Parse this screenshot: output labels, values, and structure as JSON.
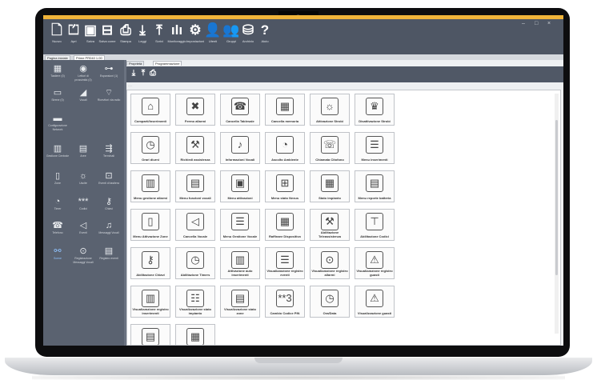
{
  "colors": {
    "accent": "#f0b43a",
    "titlebar": "#4e5664",
    "sidebar": "#5a6270",
    "selected": "#8fc3ff"
  },
  "toolbar": [
    {
      "label": "Nuovo",
      "icon": "new-file-icon",
      "glyph": "🗋"
    },
    {
      "label": "Apri",
      "icon": "open-file-icon",
      "glyph": "⏍"
    },
    {
      "label": "Salva",
      "icon": "save-icon",
      "glyph": "▣"
    },
    {
      "label": "Salva come",
      "icon": "save-as-icon",
      "glyph": "⊟"
    },
    {
      "label": "Stampa",
      "icon": "print-icon",
      "glyph": "⎙"
    },
    {
      "label": "Leggi",
      "icon": "download-icon",
      "glyph": "⤓"
    },
    {
      "label": "Scrivi",
      "icon": "upload-icon",
      "glyph": "⤒"
    },
    {
      "label": "Monitoraggio",
      "icon": "bar-chart-icon",
      "glyph": "ılı"
    },
    {
      "label": "Impostazioni",
      "icon": "gear-icon",
      "glyph": "⚙"
    },
    {
      "label": "Utenti",
      "icon": "user-icon",
      "glyph": "👤"
    },
    {
      "label": "Gruppi",
      "icon": "group-icon",
      "glyph": "👥"
    },
    {
      "label": "Archivio",
      "icon": "database-icon",
      "glyph": "⛁"
    },
    {
      "label": "Aiuto",
      "icon": "help-icon",
      "glyph": "?"
    }
  ],
  "window_controls": {
    "minimize": "–",
    "maximize": "□",
    "close": "×"
  },
  "main_tabs": [
    "Pagina iniziale",
    "Prime PR040 1.00"
  ],
  "sidebar": [
    {
      "label": "Tastiere (0)",
      "icon": "keypad-icon",
      "glyph": "▦"
    },
    {
      "label": "Lettori di prossimità (0)",
      "icon": "proximity-reader-icon",
      "glyph": "◉"
    },
    {
      "label": "Espansioni (1)",
      "icon": "expansion-icon",
      "glyph": "⊶"
    },
    {
      "label": "Sirene (0)",
      "icon": "siren-icon",
      "glyph": "▭"
    },
    {
      "label": "Vocali",
      "icon": "voice-icon",
      "glyph": "◢"
    },
    {
      "label": "Ricevitori via radio",
      "icon": "radio-receiver-icon",
      "glyph": "⌔"
    },
    {
      "label": "Configurazione Network",
      "icon": "network-icon",
      "glyph": "▬"
    },
    {
      "label": "Gestione Centrale",
      "icon": "panel-management-icon",
      "glyph": "▥"
    },
    {
      "label": "Aree",
      "icon": "areas-icon",
      "glyph": "▤"
    },
    {
      "label": "Terminali",
      "icon": "terminals-icon",
      "glyph": "⇶"
    },
    {
      "label": "Zone",
      "icon": "zones-icon",
      "glyph": "▯"
    },
    {
      "label": "Uscite",
      "icon": "outputs-icon",
      "glyph": "☼"
    },
    {
      "label": "Eventi di tastiera",
      "icon": "keypad-events-icon",
      "glyph": "⊡"
    },
    {
      "label": "Timer",
      "icon": "timer-icon",
      "glyph": "◔"
    },
    {
      "label": "Codici",
      "icon": "codes-icon",
      "glyph": "***"
    },
    {
      "label": "Chiavi",
      "icon": "keys-icon",
      "glyph": "⚷"
    },
    {
      "label": "Telefono",
      "icon": "phone-icon",
      "glyph": "☎"
    },
    {
      "label": "Eventi",
      "icon": "events-icon",
      "glyph": "◁"
    },
    {
      "label": "Messaggi Vocali",
      "icon": "voice-messages-icon",
      "glyph": "♫"
    },
    {
      "label": "Scene",
      "icon": "scenes-icon",
      "glyph": "⚯"
    },
    {
      "label": "Registrazione Messaggi Vocali",
      "icon": "record-icon",
      "glyph": "⊙"
    },
    {
      "label": "Registro eventi",
      "icon": "event-log-icon",
      "glyph": "▤"
    }
  ],
  "content_tabs": [
    "Proprietà",
    "Programmazione"
  ],
  "action_bar": [
    {
      "icon": "download-icon",
      "glyph": "⤓"
    },
    {
      "icon": "upload-icon",
      "glyph": "⤒"
    },
    {
      "icon": "print-icon",
      "glyph": "⎙"
    }
  ],
  "tiles": [
    {
      "label": "Comparti/Inserimenti",
      "icon": "house-icon",
      "glyph": "⌂"
    },
    {
      "label": "Fermo allarmi",
      "icon": "alarm-stop-icon",
      "glyph": "✖"
    },
    {
      "label": "Cancella Tablesale",
      "icon": "phone-cancel-icon",
      "glyph": "☎"
    },
    {
      "label": "Cancella memoria",
      "icon": "memory-cancel-icon",
      "glyph": "▦"
    },
    {
      "label": "Attivazione Strobi",
      "icon": "strobe-icon",
      "glyph": "☼"
    },
    {
      "label": "Disattivazione Strobi",
      "icon": "strobe-off-icon",
      "glyph": "♛"
    },
    {
      "label": "Orari diurni",
      "icon": "clock-icon",
      "glyph": "◷"
    },
    {
      "label": "Richiedi assistenza",
      "icon": "assistance-icon",
      "glyph": "⚒"
    },
    {
      "label": "Informazioni Vocali",
      "icon": "voice-info-icon",
      "glyph": "♪"
    },
    {
      "label": "Ascolto Ambiente",
      "icon": "ear-icon",
      "glyph": "◔"
    },
    {
      "label": "Chiamata Citofono",
      "icon": "intercom-icon",
      "glyph": "☏"
    },
    {
      "label": "Menu inserimenti",
      "icon": "menu-icon",
      "glyph": "☰"
    },
    {
      "label": "Menu gestione allarmi",
      "icon": "alarm-menu-icon",
      "glyph": "▥"
    },
    {
      "label": "Menu funzioni vocali",
      "icon": "voice-menu-icon",
      "glyph": "▤"
    },
    {
      "label": "Menu attivazioni",
      "icon": "activation-menu-icon",
      "glyph": "▣"
    },
    {
      "label": "Menu stato Nexus",
      "icon": "nexus-icon",
      "glyph": "⊞"
    },
    {
      "label": "Stato impianto",
      "icon": "system-status-icon",
      "glyph": "▦"
    },
    {
      "label": "Menu reporte batteria",
      "icon": "battery-menu-icon",
      "glyph": "▤"
    },
    {
      "label": "Menu Attivazione Zone",
      "icon": "zone-menu-icon",
      "glyph": "▯"
    },
    {
      "label": "Cancella Vocale",
      "icon": "voice-cancel-icon",
      "glyph": "◁"
    },
    {
      "label": "Menu Gestione Vocale",
      "icon": "voice-manage-icon",
      "glyph": "☰"
    },
    {
      "label": "Raffinare Dispositivo",
      "icon": "device-icon",
      "glyph": "▦"
    },
    {
      "label": "Abilitazione Teleassistenza",
      "icon": "teleassistance-icon",
      "glyph": "⚒"
    },
    {
      "label": "Abilitazione Codici",
      "icon": "faucet-icon",
      "glyph": "⊤"
    },
    {
      "label": "Abilitazione Chiavi",
      "icon": "key-enable-icon",
      "glyph": "⚷"
    },
    {
      "label": "Abilitazione Timers",
      "icon": "timer-enable-icon",
      "glyph": "◷"
    },
    {
      "label": "Attivazione auto inserimenti",
      "icon": "auto-arm-icon",
      "glyph": "▥"
    },
    {
      "label": "Visualizzazione registro eventi",
      "icon": "event-register-icon",
      "glyph": "☰"
    },
    {
      "label": "Visualizzazione registro allarmi",
      "icon": "alarm-register-icon",
      "glyph": "⊙"
    },
    {
      "label": "Visualizzazione registro guasti",
      "icon": "fault-register-icon",
      "glyph": "⚠"
    },
    {
      "label": "Visualizzazione registro inserimenti",
      "icon": "arm-register-icon",
      "glyph": "▥"
    },
    {
      "label": "Visualizzazione stato impianto",
      "icon": "system-view-icon",
      "glyph": "☷"
    },
    {
      "label": "Visualizzazione stato zone",
      "icon": "zone-view-icon",
      "glyph": "▤"
    },
    {
      "label": "Cambio Codice PIN",
      "icon": "pin-icon",
      "glyph": "**3"
    },
    {
      "label": "Ora/Data",
      "icon": "datetime-icon",
      "glyph": "◷"
    },
    {
      "label": "Visualizzazione guasti",
      "icon": "faults-icon",
      "glyph": "⚠"
    },
    {
      "label": "",
      "icon": "partial-tile-icon",
      "glyph": "▤"
    },
    {
      "label": "",
      "icon": "partial-tile-icon",
      "glyph": "▦"
    }
  ]
}
